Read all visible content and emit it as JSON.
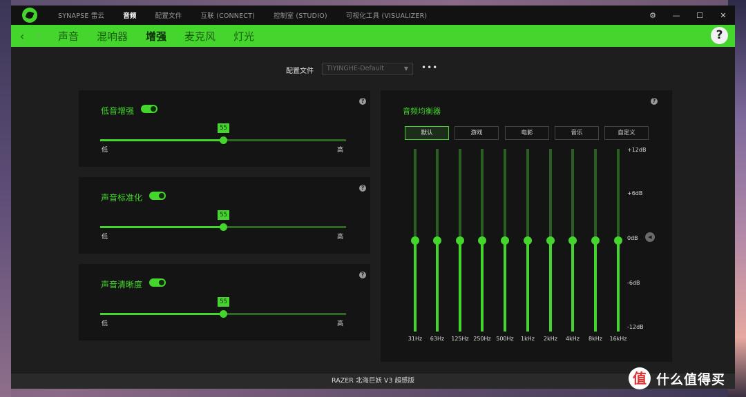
{
  "titlebar": {
    "tabs": [
      {
        "label": "SYNAPSE 雷云",
        "active": false
      },
      {
        "label": "音频",
        "active": true
      },
      {
        "label": "配置文件",
        "active": false
      },
      {
        "label": "互联 (CONNECT)",
        "active": false
      },
      {
        "label": "控制室 (STUDIO)",
        "active": false
      },
      {
        "label": "可视化工具 (VISUALIZER)",
        "active": false
      }
    ],
    "controls": {
      "settings": "⚙",
      "minimize": "—",
      "maximize": "☐",
      "close": "✕"
    }
  },
  "nav": {
    "back": "‹",
    "forward": "›",
    "tabs": [
      {
        "label": "声音",
        "active": false
      },
      {
        "label": "混响器",
        "active": false
      },
      {
        "label": "增强",
        "active": true
      },
      {
        "label": "麦克风",
        "active": false
      },
      {
        "label": "灯光",
        "active": false
      }
    ],
    "help": "?"
  },
  "profile": {
    "label": "配置文件",
    "value": "TIYINGHE-Default",
    "more": "•••"
  },
  "features": [
    {
      "title": "低音增强",
      "enabled": true,
      "value": "55",
      "level": 0.5,
      "low": "低",
      "high": "高",
      "help": "?"
    },
    {
      "title": "声音标准化",
      "enabled": true,
      "value": "55",
      "level": 0.5,
      "low": "低",
      "high": "高",
      "help": "?"
    },
    {
      "title": "声音清晰度",
      "enabled": true,
      "value": "55",
      "level": 0.5,
      "low": "低",
      "high": "高",
      "help": "?"
    }
  ],
  "equalizer": {
    "title": "音频均衡器",
    "help": "?",
    "presets": [
      {
        "label": "默认",
        "active": true
      },
      {
        "label": "游戏",
        "active": false
      },
      {
        "label": "电影",
        "active": false
      },
      {
        "label": "音乐",
        "active": false
      },
      {
        "label": "自定义",
        "active": false
      }
    ],
    "db_labels": [
      "+12dB",
      "+6dB",
      "0dB",
      "-6dB",
      "-12dB"
    ],
    "bands": [
      {
        "hz": "31Hz",
        "db": 0
      },
      {
        "hz": "63Hz",
        "db": 0
      },
      {
        "hz": "125Hz",
        "db": 0
      },
      {
        "hz": "250Hz",
        "db": 0
      },
      {
        "hz": "500Hz",
        "db": 0
      },
      {
        "hz": "1kHz",
        "db": 0
      },
      {
        "hz": "2kHz",
        "db": 0
      },
      {
        "hz": "4kHz",
        "db": 0
      },
      {
        "hz": "8kHz",
        "db": 0
      },
      {
        "hz": "16kHz",
        "db": 0
      }
    ],
    "marker": "◀"
  },
  "footer": {
    "device": "RAZER 北海巨妖 V3 超感版"
  },
  "watermark": {
    "badge": "值",
    "text": "什么值得买"
  },
  "colors": {
    "accent": "#44d62c",
    "background": "#1e1e1e",
    "panel": "#141414"
  }
}
